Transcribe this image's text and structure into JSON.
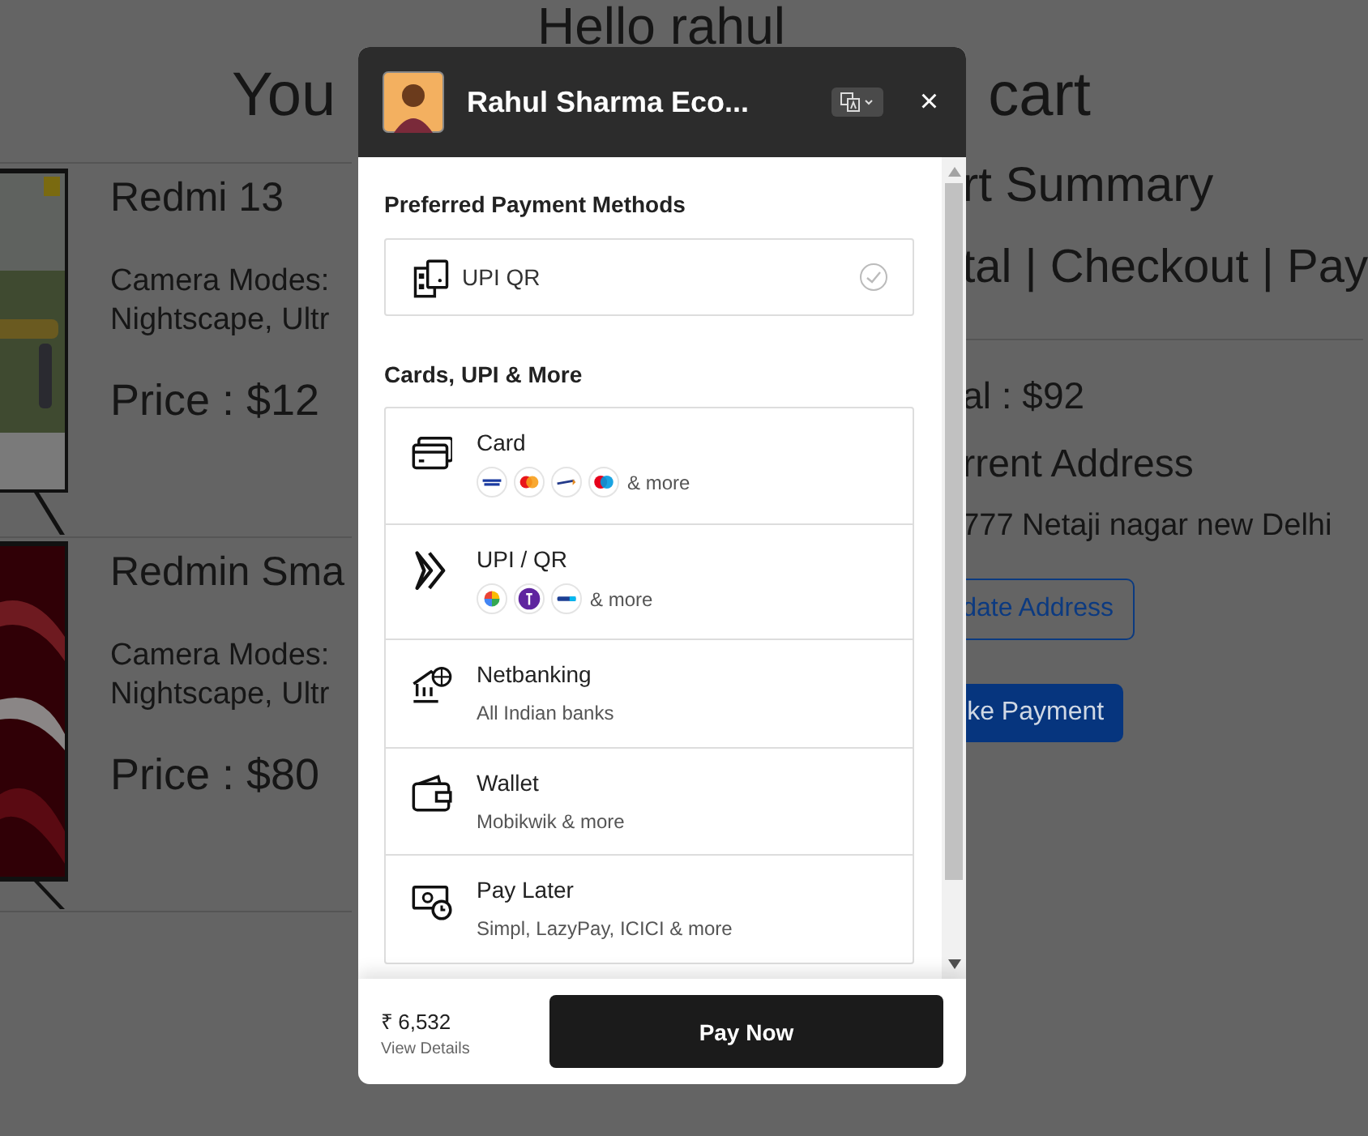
{
  "page": {
    "greeting": "Hello rahul",
    "heading_left": "You",
    "heading_right": "cart",
    "products": [
      {
        "name": "Redmi 13",
        "specs": [
          "Camera Modes:",
          "Nightscape, Ultr"
        ],
        "price": "Price : $12"
      },
      {
        "name": "Redmin Sma",
        "specs": [
          "Camera Modes:",
          "Nightscape, Ultr"
        ],
        "price": "Price : $80"
      }
    ],
    "summary": {
      "title": "rt Summary",
      "steps": "tal | Checkout | Pay",
      "total": "al : $92",
      "address_title": "rrent Address",
      "address": "777 Netaji nagar new Delhi",
      "buttons": [
        {
          "label": "date Address",
          "kind": "outline"
        },
        {
          "label": "ke Payment",
          "kind": "filled"
        }
      ]
    }
  },
  "checkout": {
    "title": "Rahul Sharma Eco...",
    "close": "×",
    "preferred": {
      "heading": "Preferred Payment Methods",
      "method": {
        "label": "UPI QR",
        "selected": false
      }
    },
    "more": {
      "heading": "Cards, UPI & More",
      "methods": [
        {
          "label": "Card",
          "kind": "logos",
          "note": "& more"
        },
        {
          "label": "UPI / QR",
          "kind": "logos",
          "note": "& more"
        },
        {
          "label": "Netbanking",
          "kind": "subtitle",
          "note": "All Indian banks"
        },
        {
          "label": "Wallet",
          "kind": "subtitle",
          "note": "Mobikwik & more"
        },
        {
          "label": "Pay Later",
          "kind": "subtitle",
          "note": "Simpl, LazyPay, ICICI & more"
        }
      ]
    },
    "amount": "₹ 6,532",
    "details_link": "View Details",
    "pay_button": "Pay Now"
  }
}
